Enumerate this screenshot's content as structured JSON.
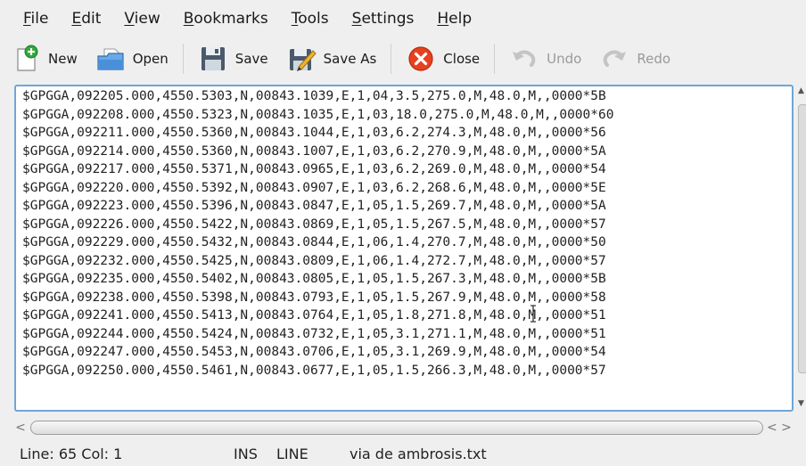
{
  "menubar": [
    {
      "pre": "",
      "u": "F",
      "post": "ile"
    },
    {
      "pre": "",
      "u": "E",
      "post": "dit"
    },
    {
      "pre": "",
      "u": "V",
      "post": "iew"
    },
    {
      "pre": "",
      "u": "B",
      "post": "ookmarks"
    },
    {
      "pre": "",
      "u": "T",
      "post": "ools"
    },
    {
      "pre": "",
      "u": "S",
      "post": "ettings"
    },
    {
      "pre": "",
      "u": "H",
      "post": "elp"
    }
  ],
  "toolbar": {
    "new_label": "New",
    "open_label": "Open",
    "save_label": "Save",
    "saveas_label": "Save As",
    "close_label": "Close",
    "undo_label": "Undo",
    "redo_label": "Redo",
    "colors": {
      "close": "#e8411f",
      "new_badge": "#2fa83a",
      "folder": "#4a90d9",
      "disk": "#4a5a6a"
    }
  },
  "editor": {
    "lines": [
      "$GPGGA,092205.000,4550.5303,N,00843.1039,E,1,04,3.5,275.0,M,48.0,M,,0000*5B",
      "$GPGGA,092208.000,4550.5323,N,00843.1035,E,1,03,18.0,275.0,M,48.0,M,,0000*60",
      "$GPGGA,092211.000,4550.5360,N,00843.1044,E,1,03,6.2,274.3,M,48.0,M,,0000*56",
      "$GPGGA,092214.000,4550.5360,N,00843.1007,E,1,03,6.2,270.9,M,48.0,M,,0000*5A",
      "$GPGGA,092217.000,4550.5371,N,00843.0965,E,1,03,6.2,269.0,M,48.0,M,,0000*54",
      "$GPGGA,092220.000,4550.5392,N,00843.0907,E,1,03,6.2,268.6,M,48.0,M,,0000*5E",
      "$GPGGA,092223.000,4550.5396,N,00843.0847,E,1,05,1.5,269.7,M,48.0,M,,0000*5A",
      "$GPGGA,092226.000,4550.5422,N,00843.0869,E,1,05,1.5,267.5,M,48.0,M,,0000*57",
      "$GPGGA,092229.000,4550.5432,N,00843.0844,E,1,06,1.4,270.7,M,48.0,M,,0000*50",
      "$GPGGA,092232.000,4550.5425,N,00843.0809,E,1,06,1.4,272.7,M,48.0,M,,0000*57",
      "$GPGGA,092235.000,4550.5402,N,00843.0805,E,1,05,1.5,267.3,M,48.0,M,,0000*5B",
      "$GPGGA,092238.000,4550.5398,N,00843.0793,E,1,05,1.5,267.9,M,48.0,M,,0000*58",
      "$GPGGA,092241.000,4550.5413,N,00843.0764,E,1,05,1.8,271.8,M,48.0,M,,0000*51",
      "$GPGGA,092244.000,4550.5424,N,00843.0732,E,1,05,3.1,271.1,M,48.0,M,,0000*51",
      "$GPGGA,092247.000,4550.5453,N,00843.0706,E,1,05,3.1,269.9,M,48.0,M,,0000*54",
      "$GPGGA,092250.000,4550.5461,N,00843.0677,E,1,05,1.5,266.3,M,48.0,M,,0000*57"
    ]
  },
  "scrollbars": {
    "h_left": "<",
    "h_right": "< >",
    "v_up": "▲",
    "v_down": "▼"
  },
  "statusbar": {
    "line_col": "Line: 65 Col: 1",
    "ins": "INS",
    "mode": "LINE",
    "filename": "via de ambrosis.txt"
  }
}
